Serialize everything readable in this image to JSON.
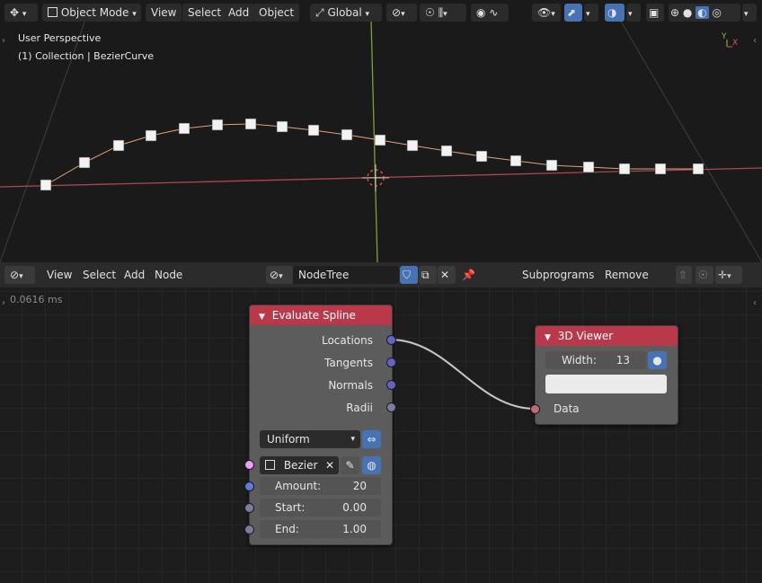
{
  "top_header": {
    "editor_type_icon": "axes-icon",
    "mode": "Object Mode",
    "menus": [
      "View",
      "Select",
      "Add",
      "Object"
    ],
    "transform_orientation": "Global"
  },
  "viewport": {
    "view_name": "User Perspective",
    "collection": "(1) Collection | BezierCurve",
    "axis_gizmo": {
      "y": "Y",
      "x": "X"
    }
  },
  "node_header": {
    "menus": [
      "View",
      "Select",
      "Add",
      "Node"
    ],
    "tree_name": "NodeTree",
    "subprograms": "Subprograms",
    "remove": "Remove"
  },
  "node_editor": {
    "timing": "0.0616 ms"
  },
  "evaluate_spline": {
    "title": "Evaluate Spline",
    "outputs": [
      "Locations",
      "Tangents",
      "Normals",
      "Radii"
    ],
    "mode": "Uniform",
    "object": "Bezier",
    "amount_label": "Amount:",
    "amount": "20",
    "start_label": "Start:",
    "start": "0.00",
    "end_label": "End:",
    "end": "1.00"
  },
  "viewer": {
    "title": "3D Viewer",
    "width_label": "Width:",
    "width": "13",
    "data_label": "Data"
  },
  "colors": {
    "node_header": "#b9384a",
    "vector_socket": "#6363c7",
    "float_socket": "#a1a1a1",
    "object_socket": "#ed9ef8",
    "accent": "#4772b3"
  }
}
